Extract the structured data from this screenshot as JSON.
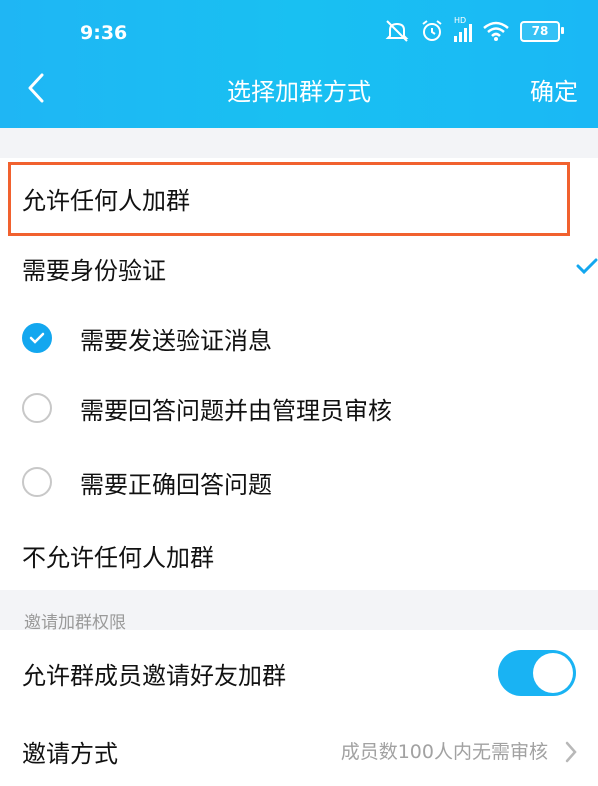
{
  "status_bar": {
    "time": "9:36",
    "battery": "78",
    "hd_label": "HD"
  },
  "nav": {
    "title": "选择加群方式",
    "confirm_label": "确定"
  },
  "options": {
    "allow_anyone": "允许任何人加群",
    "require_verification": "需要身份验证",
    "sub_options": [
      {
        "label": "需要发送验证消息",
        "checked": true
      },
      {
        "label": "需要回答问题并由管理员审核",
        "checked": false
      },
      {
        "label": "需要正确回答问题",
        "checked": false
      }
    ],
    "disallow_anyone": "不允许任何人加群"
  },
  "invite_section": {
    "header": "邀请加群权限",
    "allow_member_invite": {
      "label": "允许群成员邀请好友加群",
      "enabled": true
    },
    "invite_method": {
      "label": "邀请方式",
      "value": "成员数100人内无需审核"
    }
  },
  "colors": {
    "accent": "#13a7ef",
    "highlight_border": "#f1612e",
    "header_bg": "#1fb6f4"
  }
}
